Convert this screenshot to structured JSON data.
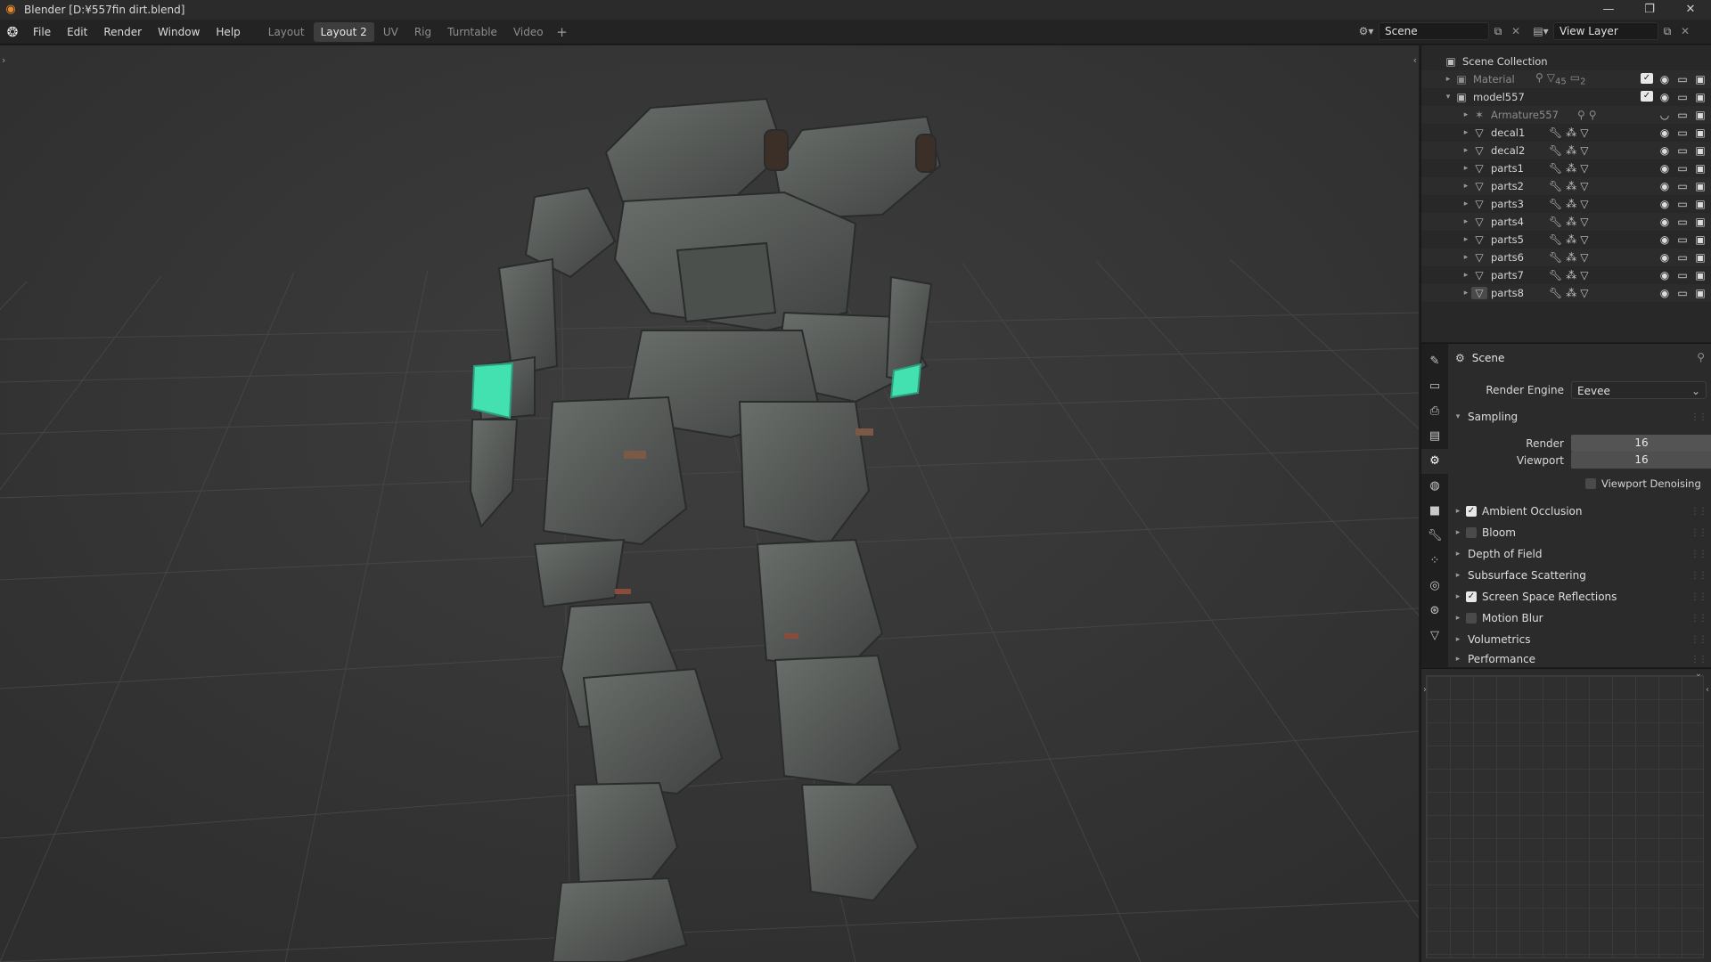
{
  "window": {
    "title": "Blender [D:¥557fin dirt.blend]",
    "controls": [
      "—",
      "❐",
      "✕"
    ]
  },
  "menu": {
    "items": [
      "File",
      "Edit",
      "Render",
      "Window",
      "Help"
    ]
  },
  "workspaces": {
    "tabs": [
      "Layout",
      "Layout 2",
      "UV",
      "Rig",
      "Turntable",
      "Video"
    ],
    "active": "Layout 2",
    "add_label": "+"
  },
  "header_right": {
    "scene_name": "Scene",
    "view_layer_name": "View Layer"
  },
  "outliner": {
    "root": "Scene Collection",
    "collections": [
      {
        "name": "Material",
        "expanded": false,
        "mod_counts": [
          "45",
          "2"
        ]
      },
      {
        "name": "model557",
        "expanded": true
      }
    ],
    "objects": [
      "Armature557",
      "decal1",
      "decal2",
      "parts1",
      "parts2",
      "parts3",
      "parts4",
      "parts5",
      "parts6",
      "parts7",
      "parts8"
    ]
  },
  "properties": {
    "context": "Scene",
    "render_engine_label": "Render Engine",
    "render_engine_value": "Eevee",
    "sampling": {
      "title": "Sampling",
      "render_label": "Render",
      "render_value": "16",
      "viewport_label": "Viewport",
      "viewport_value": "16",
      "denoise_label": "Viewport Denoising"
    },
    "panels": [
      {
        "label": "Ambient Occlusion",
        "checkbox": true,
        "checked": true
      },
      {
        "label": "Bloom",
        "checkbox": true,
        "checked": false
      },
      {
        "label": "Depth of Field",
        "checkbox": false
      },
      {
        "label": "Subsurface Scattering",
        "checkbox": false
      },
      {
        "label": "Screen Space Reflections",
        "checkbox": true,
        "checked": true
      },
      {
        "label": "Motion Blur",
        "checkbox": true,
        "checked": false
      },
      {
        "label": "Volumetrics",
        "checkbox": false
      },
      {
        "label": "Performance",
        "checkbox": false
      }
    ]
  },
  "colors": {
    "accent_glow": "#43e0b0",
    "viewport_bg": "#3a3a3a",
    "robot_body": "#565a57"
  }
}
